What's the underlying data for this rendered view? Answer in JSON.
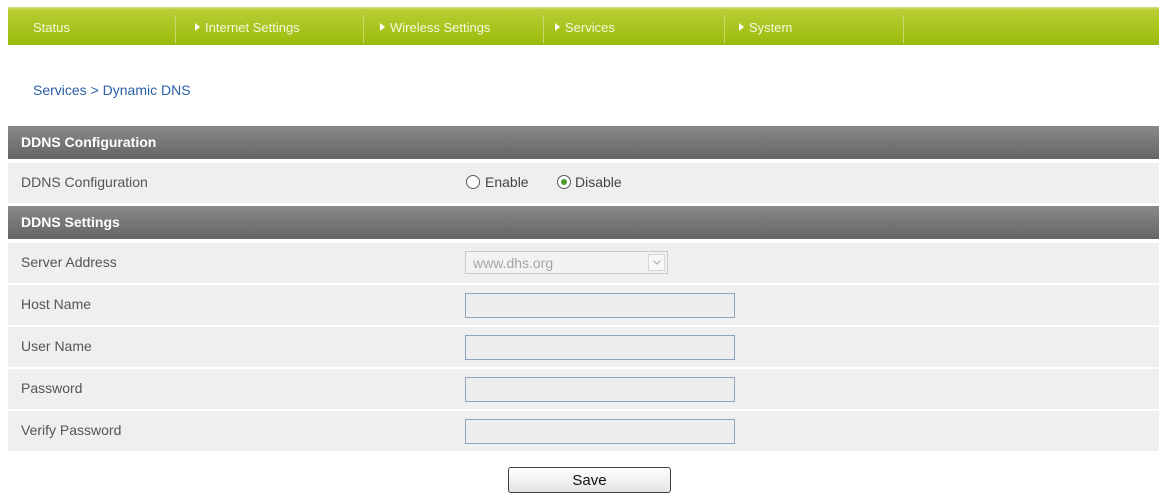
{
  "nav": {
    "items": [
      {
        "label": "Status",
        "has_arrow": false
      },
      {
        "label": "Internet Settings",
        "has_arrow": true
      },
      {
        "label": "Wireless Settings",
        "has_arrow": true
      },
      {
        "label": "Services",
        "has_arrow": true
      },
      {
        "label": "System",
        "has_arrow": true
      }
    ],
    "color": "#99bb0a"
  },
  "breadcrumb": "Services > Dynamic DNS",
  "ddns_config": {
    "header": "DDNS Configuration",
    "label": "DDNS Configuration",
    "options": {
      "enable": "Enable",
      "disable": "Disable"
    },
    "selected": "Disable"
  },
  "ddns_settings": {
    "header": "DDNS Settings",
    "server_address": {
      "label": "Server Address",
      "value": "www.dhs.org",
      "disabled": true
    },
    "host_name": {
      "label": "Host Name",
      "value": ""
    },
    "user_name": {
      "label": "User Name",
      "value": ""
    },
    "password": {
      "label": "Password",
      "value": ""
    },
    "verify_password": {
      "label": "Verify Password",
      "value": ""
    }
  },
  "actions": {
    "save_label": "Save"
  },
  "colors": {
    "nav_bar": "#99bb0a",
    "section_header": "#6e6e6e",
    "row_bg": "#efefef",
    "breadcrumb": "#2a5fa6"
  }
}
